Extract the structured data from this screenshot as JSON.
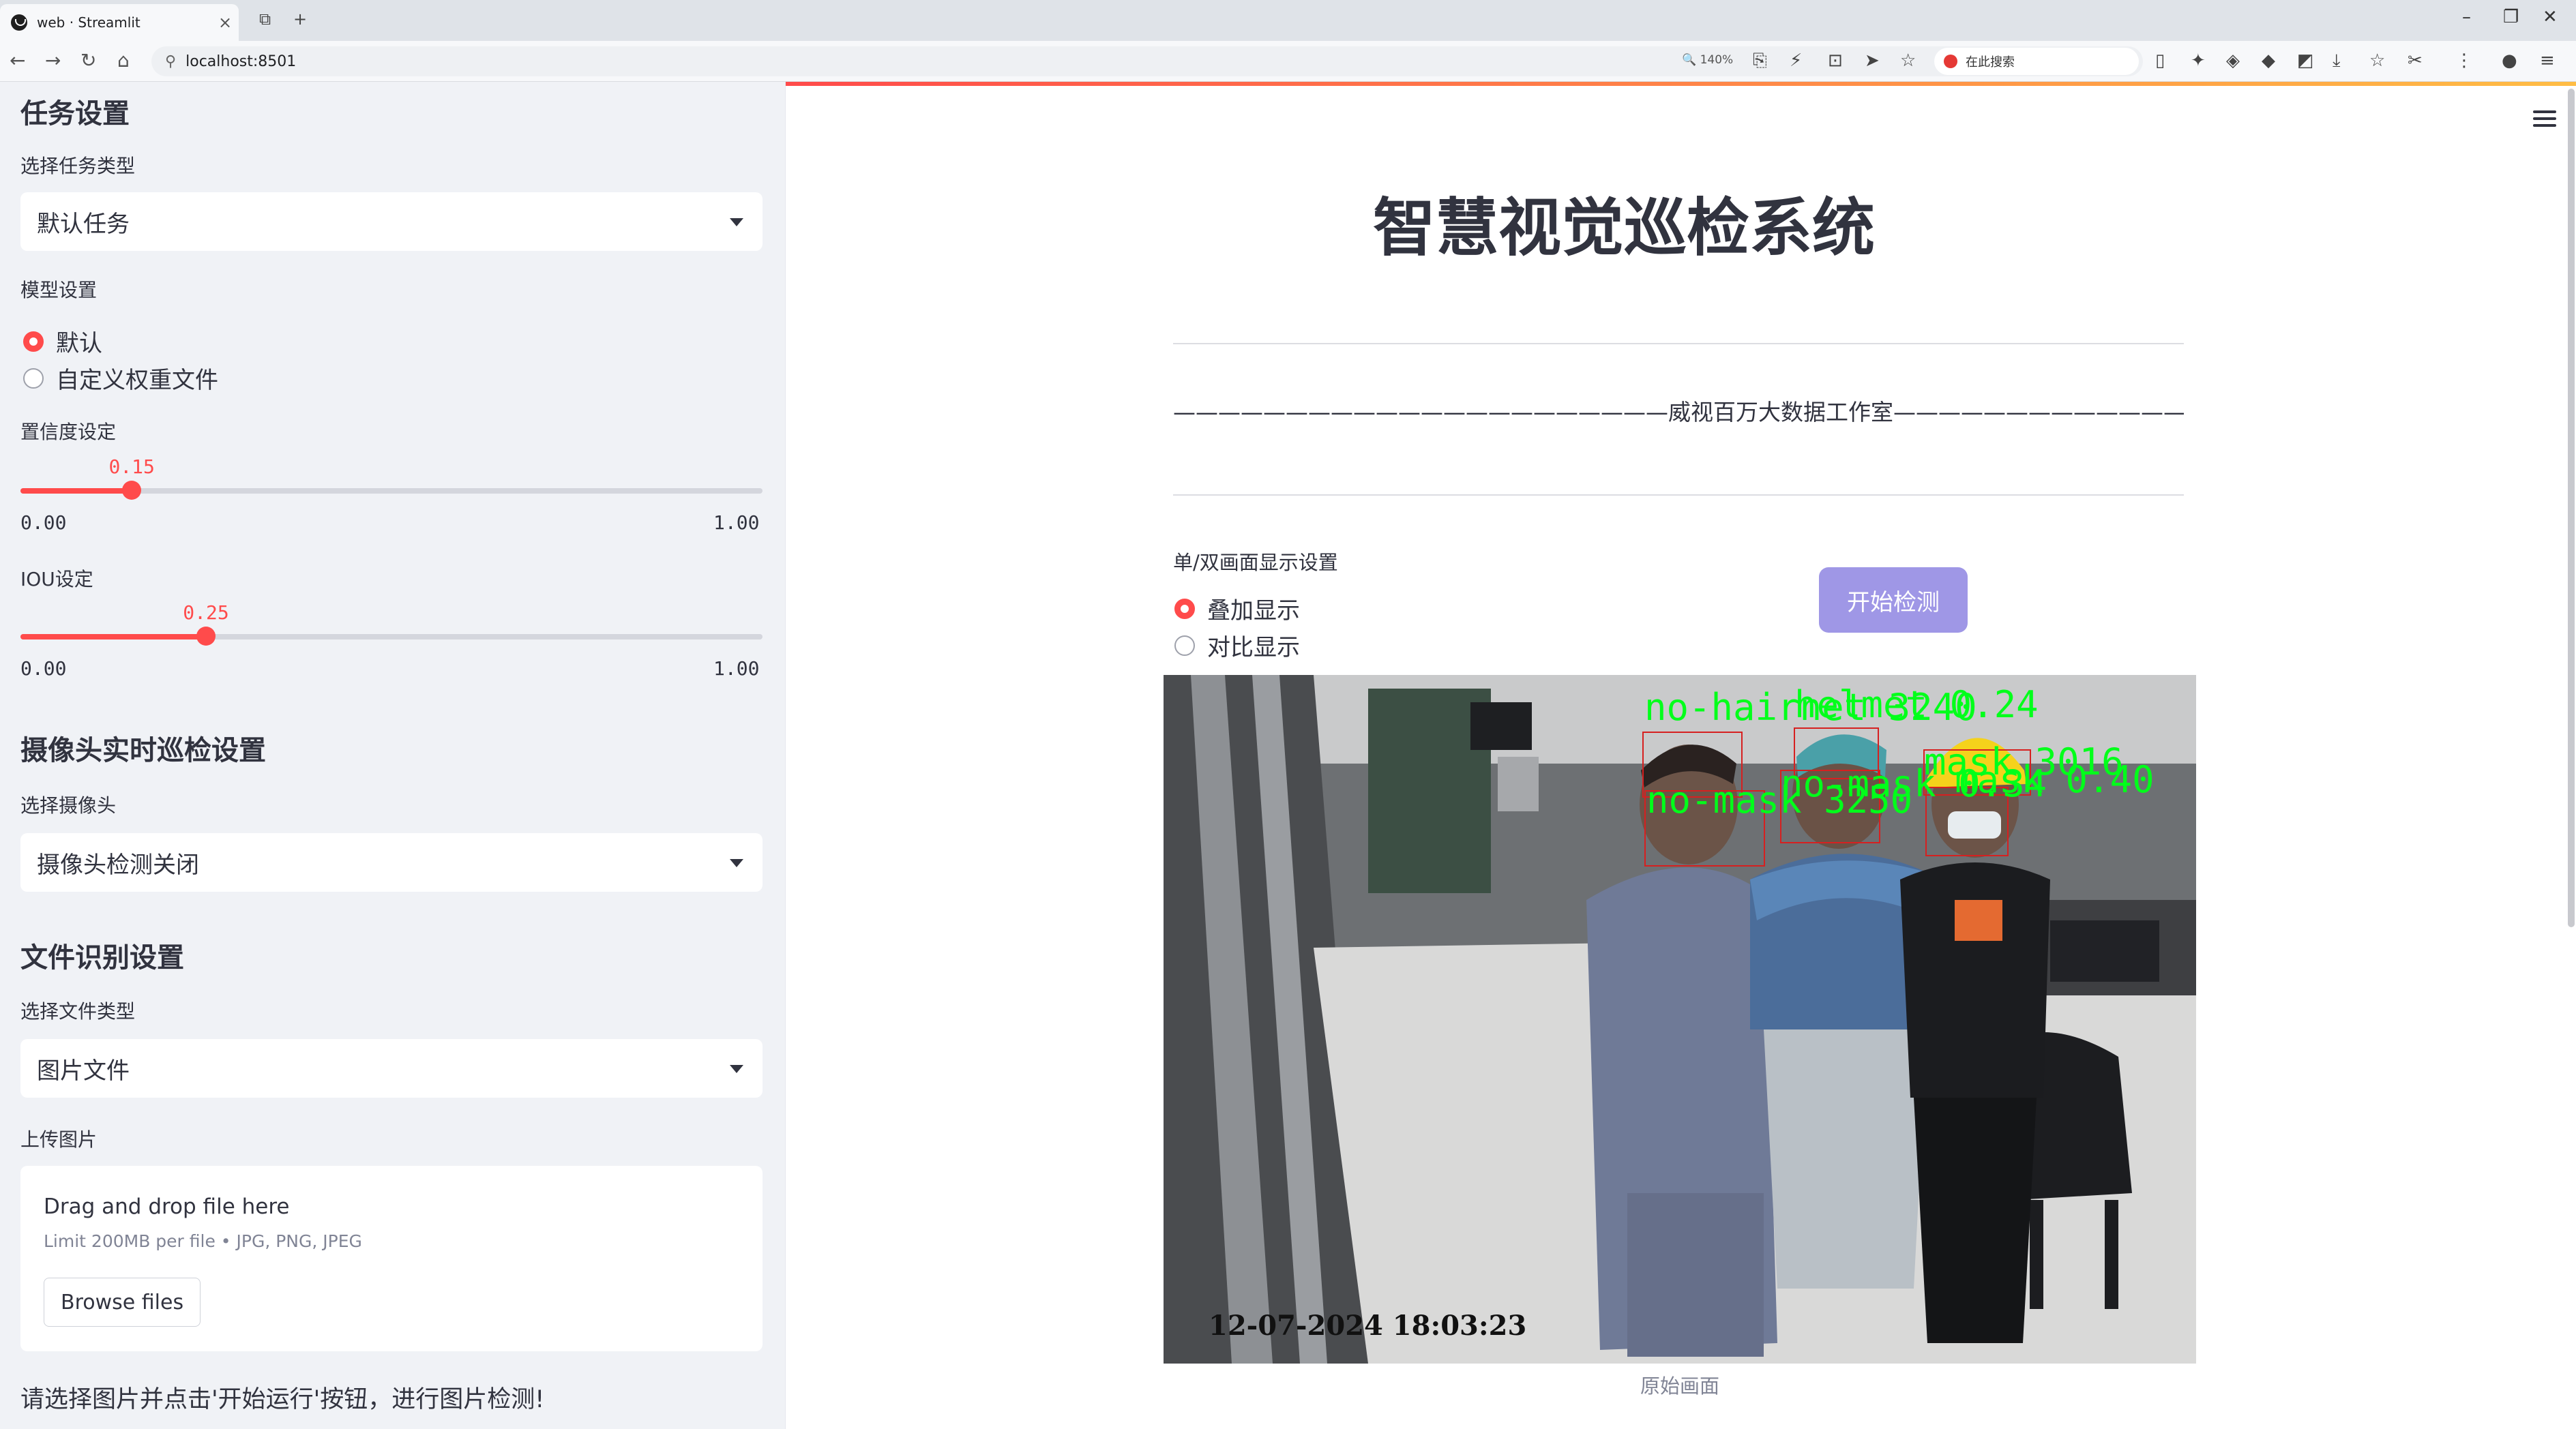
{
  "browser": {
    "tab_title": "web · Streamlit",
    "url": "localhost:8501",
    "zoom": "140%",
    "search_placeholder": "在此搜索"
  },
  "sidebar": {
    "task_section_title": "任务设置",
    "task_type_label": "选择任务类型",
    "task_type_value": "默认任务",
    "model_label": "模型设置",
    "model_options": [
      "默认",
      "自定义权重文件"
    ],
    "model_selected": "默认",
    "conf_label": "置信度设定",
    "conf_value": "0.15",
    "conf_fraction": 0.15,
    "conf_min": "0.00",
    "conf_max": "1.00",
    "iou_label": "IOU设定",
    "iou_value": "0.25",
    "iou_fraction": 0.25,
    "iou_min": "0.00",
    "iou_max": "1.00",
    "camera_section_title": "摄像头实时巡检设置",
    "camera_label": "选择摄像头",
    "camera_value": "摄像头检测关闭",
    "file_section_title": "文件识别设置",
    "file_type_label": "选择文件类型",
    "file_type_value": "图片文件",
    "upload_label": "上传图片",
    "upload_drop_text": "Drag and drop file here",
    "upload_limit_text": "Limit 200MB per file • JPG, PNG, JPEG",
    "upload_button": "Browse files",
    "info_text": "请选择图片并点击'开始运行'按钮，进行图片检测!"
  },
  "main": {
    "title": "智慧视觉巡检系统",
    "subtitle": "——————————————————————威视百万大数据工作室————————————————————————",
    "display_label": "单/双画面显示设置",
    "display_options": [
      "叠加显示",
      "对比显示"
    ],
    "display_selected": "叠加显示",
    "start_button": "开始检测",
    "image_caption": "原始画面",
    "timestamp": "12-07-2024 18:03:23",
    "detections": [
      "no-hairnet 3240",
      "helmet 0.24",
      "no-mask 3250",
      "no-mask 0.34",
      "mask 3016",
      "mask 0.40"
    ]
  },
  "colors": {
    "accent": "#ff4b4b",
    "button": "#9f97e6",
    "sidebar_bg": "#f0f2f6",
    "detection_green": "#00ff1a",
    "detection_box": "#d62020"
  }
}
